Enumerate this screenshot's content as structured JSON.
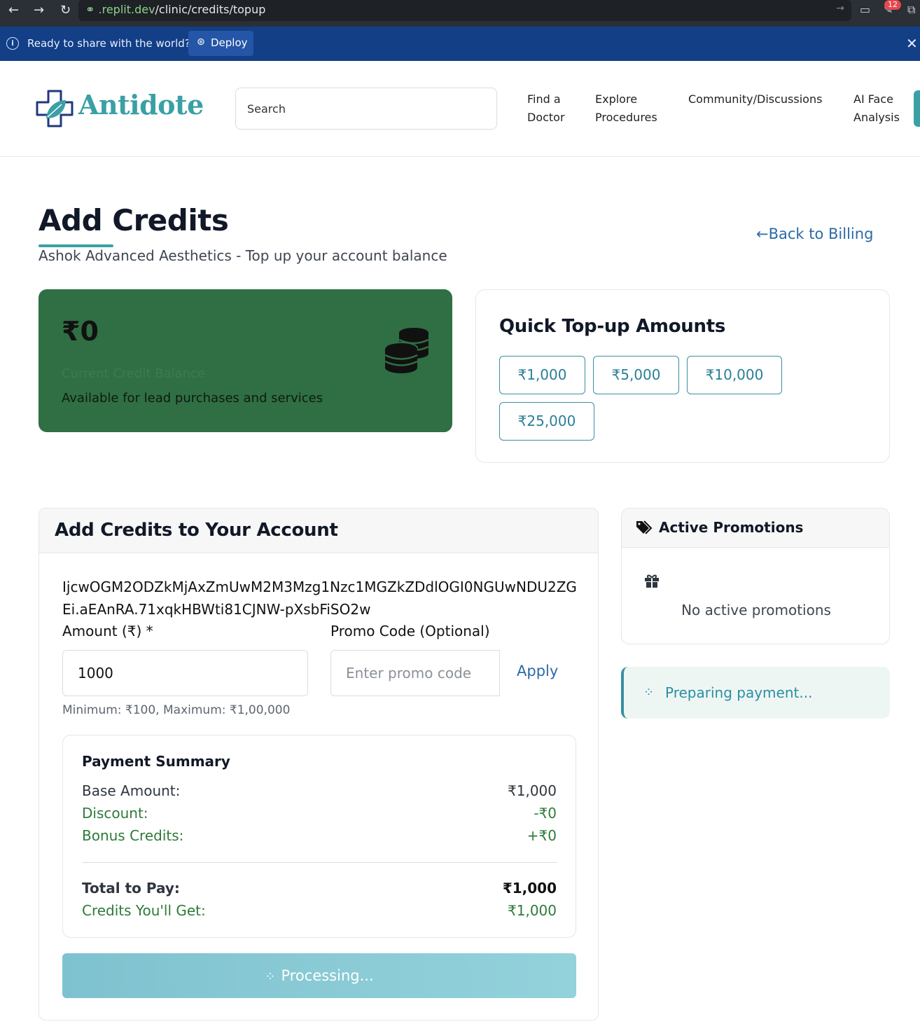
{
  "browser": {
    "url_host": ".replit.dev",
    "url_path": "/clinic/credits/topup",
    "notification_count": "12"
  },
  "banner": {
    "text": "Ready to share with the world?",
    "deploy_label": "Deploy"
  },
  "header": {
    "logo_text": "Antidote",
    "search_placeholder": "Search",
    "nav": [
      {
        "line1": "Find a",
        "line2": "Doctor"
      },
      {
        "line1": "Explore",
        "line2": "Procedures"
      },
      {
        "line1": "Community/Discussions",
        "line2": ""
      },
      {
        "line1": "AI Face",
        "line2": "Analysis"
      }
    ]
  },
  "page": {
    "title": "Add Credits",
    "subtitle": "Ashok Advanced Aesthetics - Top up your account balance",
    "back_label": "Back to Billing"
  },
  "balance": {
    "amount": "₹0",
    "label": "Current Credit Balance",
    "note": "Available for lead purchases and services"
  },
  "quick_topup": {
    "title": "Quick Top-up Amounts",
    "amounts": [
      "₹1,000",
      "₹5,000",
      "₹10,000",
      "₹25,000"
    ]
  },
  "add_credits": {
    "title": "Add Credits to Your Account",
    "token": "IjcwOGM2ODZkMjAxZmUwM2M3Mzg1Nzc1MGZkZDdlOGI0NGUwNDU2ZGEi.aEAnRA.71xqkHBWti81CJNW-pXsbFiSO2w",
    "amount_label": "Amount (₹) *",
    "amount_value": "1000",
    "promo_label": "Promo Code (Optional)",
    "promo_placeholder": "Enter promo code",
    "apply_label": "Apply",
    "minmax": "Minimum: ₹100, Maximum: ₹1,00,000",
    "process_label": "Processing..."
  },
  "summary": {
    "title": "Payment Summary",
    "base_label": "Base Amount:",
    "base_value": "₹1,000",
    "discount_label": "Discount:",
    "discount_value": "-₹0",
    "bonus_label": "Bonus Credits:",
    "bonus_value": "+₹0",
    "total_label": "Total to Pay:",
    "total_value": "₹1,000",
    "credits_label": "Credits You'll Get:",
    "credits_value": "₹1,000"
  },
  "promotions": {
    "title": "Active Promotions",
    "empty_text": "No active promotions"
  },
  "status": {
    "preparing": "Preparing payment..."
  },
  "colors": {
    "brand_teal": "#3aa0a5",
    "balance_green": "#2f6f43",
    "link_blue": "#2c6aa8",
    "summary_green": "#2e7a3a"
  }
}
